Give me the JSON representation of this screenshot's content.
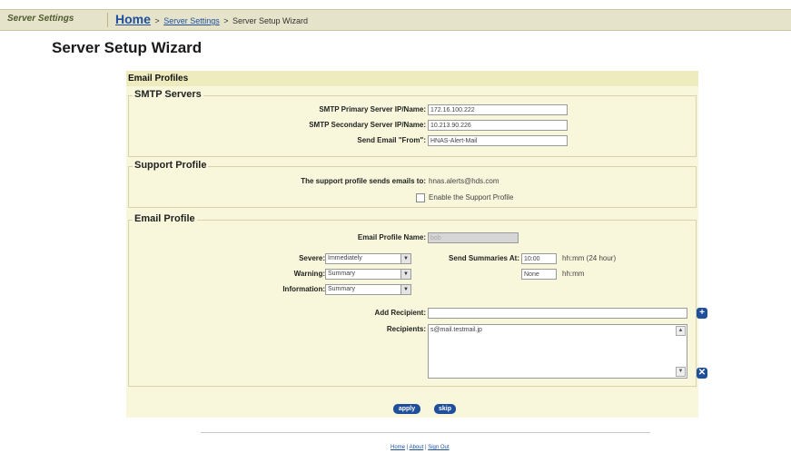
{
  "header": {
    "section": "Server Settings",
    "breadcrumb": {
      "home": "Home",
      "sep": ">",
      "server_settings": "Server Settings",
      "current": "Server Setup Wizard"
    }
  },
  "page_title": "Server Setup Wizard",
  "panel": {
    "title": "Email Profiles",
    "smtp": {
      "legend": "SMTP Servers",
      "primary_label": "SMTP Primary Server IP/Name:",
      "primary_value": "172.16.100.222",
      "secondary_label": "SMTP Secondary Server IP/Name:",
      "secondary_value": "10.213.90.226",
      "from_label": "Send Email \"From\":",
      "from_value": "HNAS-Alert-Mail"
    },
    "support": {
      "legend": "Support Profile",
      "sends_label": "The support profile sends emails to:",
      "sends_value": "hnas.alerts@hds.com",
      "enable_label": "Enable the Support Profile",
      "enabled": false
    },
    "email_profile": {
      "legend": "Email Profile",
      "name_label": "Email Profile Name:",
      "name_value": "bob",
      "severe_label": "Severe:",
      "severe_value": "Immediately",
      "warning_label": "Warning:",
      "warning_value": "Summary",
      "information_label": "Information:",
      "information_value": "Summary",
      "summaries_label": "Send Summaries At:",
      "summary_time1": "10:00",
      "summary_time1_hint": "hh:mm (24 hour)",
      "summary_time2": "None",
      "summary_time2_hint": "hh:mm",
      "add_recipient_label": "Add Recipient:",
      "add_recipient_value": "",
      "recipients_label": "Recipients:",
      "recipients": [
        "s@mail.testmail.jp"
      ]
    },
    "buttons": {
      "apply": "apply",
      "skip": "skip"
    }
  },
  "footer": {
    "home": "Home",
    "about": "About",
    "sign_out": "Sign Out",
    "sep": "|"
  },
  "colors": {
    "accent": "#1f4f9a",
    "panel_bg": "#f8f7dc",
    "header_bg": "#eeecbe",
    "topbar_bg": "#e5e3c9"
  }
}
